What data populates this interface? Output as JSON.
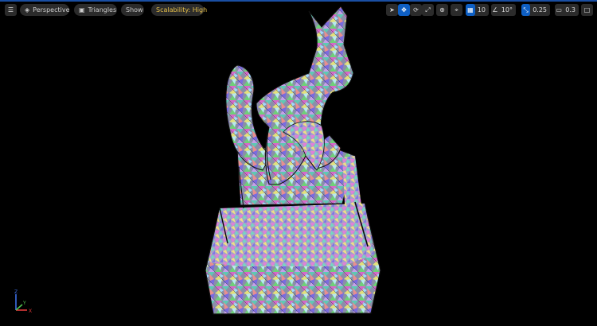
{
  "toolbar": {
    "menu_icon": "hamburger-icon",
    "perspective_label": "Perspective",
    "triangles_label": "Triangles",
    "show_label": "Show",
    "scalability_label": "Scalability: High",
    "grid_snap_value": "10",
    "angle_snap_value": "10°",
    "scale_snap_value": "0.25",
    "camera_speed_value": "0.3"
  },
  "axis": {
    "x_label": "X",
    "y_label": "Y",
    "z_label": "Z"
  },
  "colors": {
    "background": "#000000",
    "toolbar_button": "#2b2b2b",
    "accent_blue": "#0e5fc4",
    "scalability_text": "#e8c14a",
    "axis_x": "#e03a3a",
    "axis_y": "#4fc24f",
    "axis_z": "#3d6fe6"
  }
}
